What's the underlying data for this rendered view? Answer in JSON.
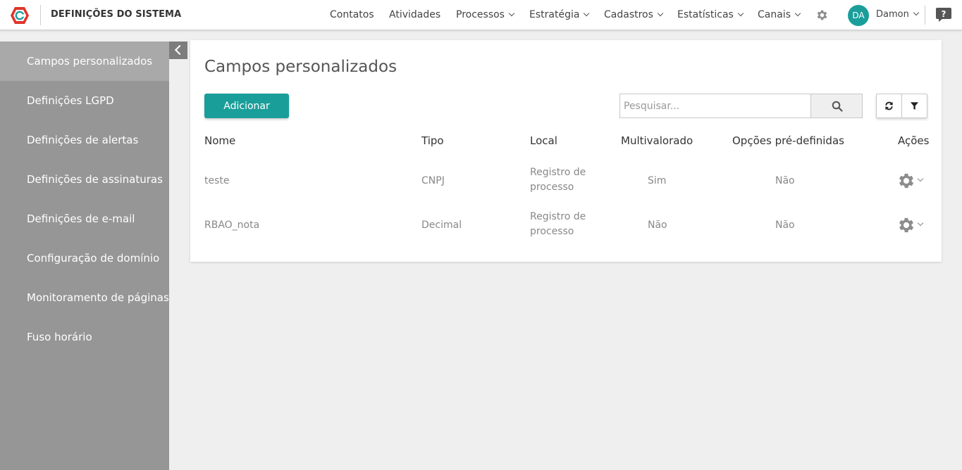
{
  "app": {
    "title": "DEFINIÇÕES DO SISTEMA",
    "accent_color": "#1a9e9a",
    "logo_color": "#e0342b"
  },
  "nav": {
    "items": [
      {
        "label": "Contatos",
        "icon": null
      },
      {
        "label": "Atividades",
        "icon": null
      },
      {
        "label": "Processos",
        "icon": "chevron-down-icon"
      },
      {
        "label": "Estratégia",
        "icon": "chevron-down-icon"
      },
      {
        "label": "Cadastros",
        "icon": "chevron-down-icon"
      },
      {
        "label": "Estatísticas",
        "icon": "chevron-down-icon"
      },
      {
        "label": "Canais",
        "icon": "chevron-down-icon"
      }
    ],
    "settings_icon": "gear-icon",
    "help_icon": "help-icon"
  },
  "user": {
    "initials": "DA",
    "name": "Damon"
  },
  "sidebar": {
    "items": [
      {
        "label": "Campos personalizados",
        "active": true
      },
      {
        "label": "Definições LGPD",
        "active": false
      },
      {
        "label": "Definições de alertas",
        "active": false
      },
      {
        "label": "Definições de assinaturas",
        "active": false
      },
      {
        "label": "Definições de e-mail",
        "active": false
      },
      {
        "label": "Configuração de domínio",
        "active": false
      },
      {
        "label": "Monitoramento de páginas",
        "active": false
      },
      {
        "label": "Fuso horário",
        "active": false
      }
    ]
  },
  "main": {
    "title": "Campos personalizados",
    "add_label": "Adicionar",
    "search": {
      "placeholder": "Pesquisar...",
      "value": ""
    },
    "table": {
      "headers": [
        "Nome",
        "Tipo",
        "Local",
        "Multivalorado",
        "Opções pré-definidas",
        "Ações"
      ],
      "rows": [
        {
          "nome": "teste",
          "tipo": "CNPJ",
          "local": "Registro de processo",
          "multivalorado": "Sim",
          "opcoes": "Não"
        },
        {
          "nome": "RBAO_nota",
          "tipo": "Decimal",
          "local": "Registro de processo",
          "multivalorado": "Não",
          "opcoes": "Não"
        }
      ]
    }
  }
}
